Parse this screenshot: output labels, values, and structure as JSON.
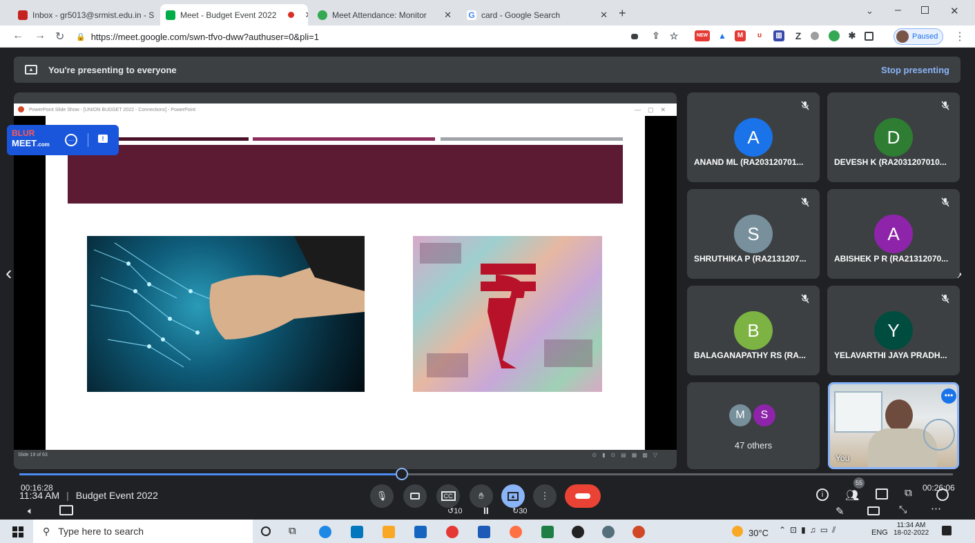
{
  "browser": {
    "tabs": [
      {
        "label": "Inbox - gr5013@srmist.edu.in - S",
        "favicon": "gmail-icon"
      },
      {
        "label": "Meet - Budget Event 2022",
        "favicon": "meet-icon"
      },
      {
        "label": "Meet Attendance: Monitor",
        "favicon": "extension-icon"
      },
      {
        "label": "card - Google Search",
        "favicon": "google-icon"
      }
    ],
    "url": "https://meet.google.com/swn-tfvo-dww?authuser=0&pli=1",
    "profile_status": "Paused"
  },
  "banner": {
    "text": "You're presenting to everyone",
    "stop_label": "Stop presenting"
  },
  "blurmeet": {
    "brand_top": "BLUR",
    "brand_bottom": "MEET",
    "brand_suffix": ".com"
  },
  "slide": {
    "ppt_title": "PowerPoint Slide Show - [UNION BUDGET 2022 - Connections] - PowerPoint",
    "slide_counter": "Slide 19 of 63",
    "header_color": "#5c1a33"
  },
  "participants": [
    {
      "initial": "A",
      "name": "ANAND ML (RA203120701...",
      "color": "#1a73e8"
    },
    {
      "initial": "D",
      "name": "DEVESH K (RA2031207010...",
      "color": "#2e7d32"
    },
    {
      "initial": "S",
      "name": "SHRUTHIKA P (RA2131207...",
      "color": "#78909c"
    },
    {
      "initial": "A",
      "name": "ABISHEK P R (RA21312070...",
      "color": "#8e24aa"
    },
    {
      "initial": "B",
      "name": "BALAGANAPATHY RS (RA...",
      "color": "#7cb342"
    },
    {
      "initial": "Y",
      "name": "YELAVARTHI JAYA PRADH...",
      "color": "#004d40"
    }
  ],
  "others": {
    "initials": [
      "M",
      "S"
    ],
    "label": "47 others"
  },
  "self_tile": {
    "label": "You"
  },
  "bottom": {
    "elapsed": "00:16:28",
    "time": "11:34 AM",
    "separator": "|",
    "meeting_name": "Budget Event 2022",
    "remaining": "00:26:06",
    "people_count": "55",
    "rewind": "10",
    "forward": "30",
    "progress": 0.41
  },
  "taskbar": {
    "search_placeholder": "Type here to search",
    "weather": "30°C",
    "language": "ENG",
    "clock_time": "11:34 AM",
    "clock_date": "18-02-2022"
  }
}
